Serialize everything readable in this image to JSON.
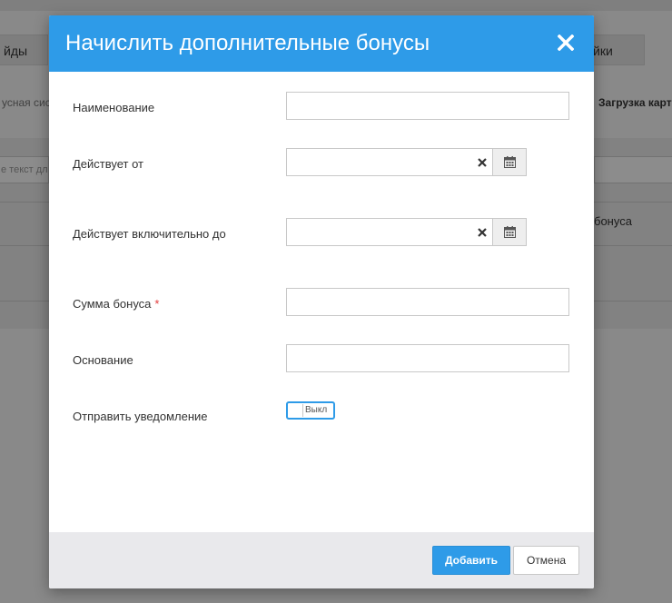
{
  "background": {
    "tab_left_label": "йды",
    "tab_right_label": "йки",
    "strip_left_text": "усная сис",
    "strip_right_text": "Загрузка карт",
    "filter_placeholder_left": "е текст дл",
    "cell_right_text": "бонуса"
  },
  "modal": {
    "title": "Начислить дополнительные бонусы",
    "close_icon": "close-icon",
    "fields": {
      "name": {
        "label": "Наименование",
        "value": ""
      },
      "valid_from": {
        "label": "Действует от",
        "value": ""
      },
      "valid_to": {
        "label": "Действует включительно до",
        "value": ""
      },
      "bonus_amount": {
        "label": "Сумма бонуса",
        "required_mark": "*",
        "value": ""
      },
      "reason": {
        "label": "Основание",
        "value": ""
      },
      "notify": {
        "label": "Отправить уведомление",
        "toggle_text": "Выкл",
        "state": "off"
      }
    },
    "footer": {
      "add_label": "Добавить",
      "cancel_label": "Отмена"
    }
  },
  "colors": {
    "accent": "#2e9be8",
    "required": "#e23b3b",
    "footer_bg": "#e9e9ec"
  }
}
